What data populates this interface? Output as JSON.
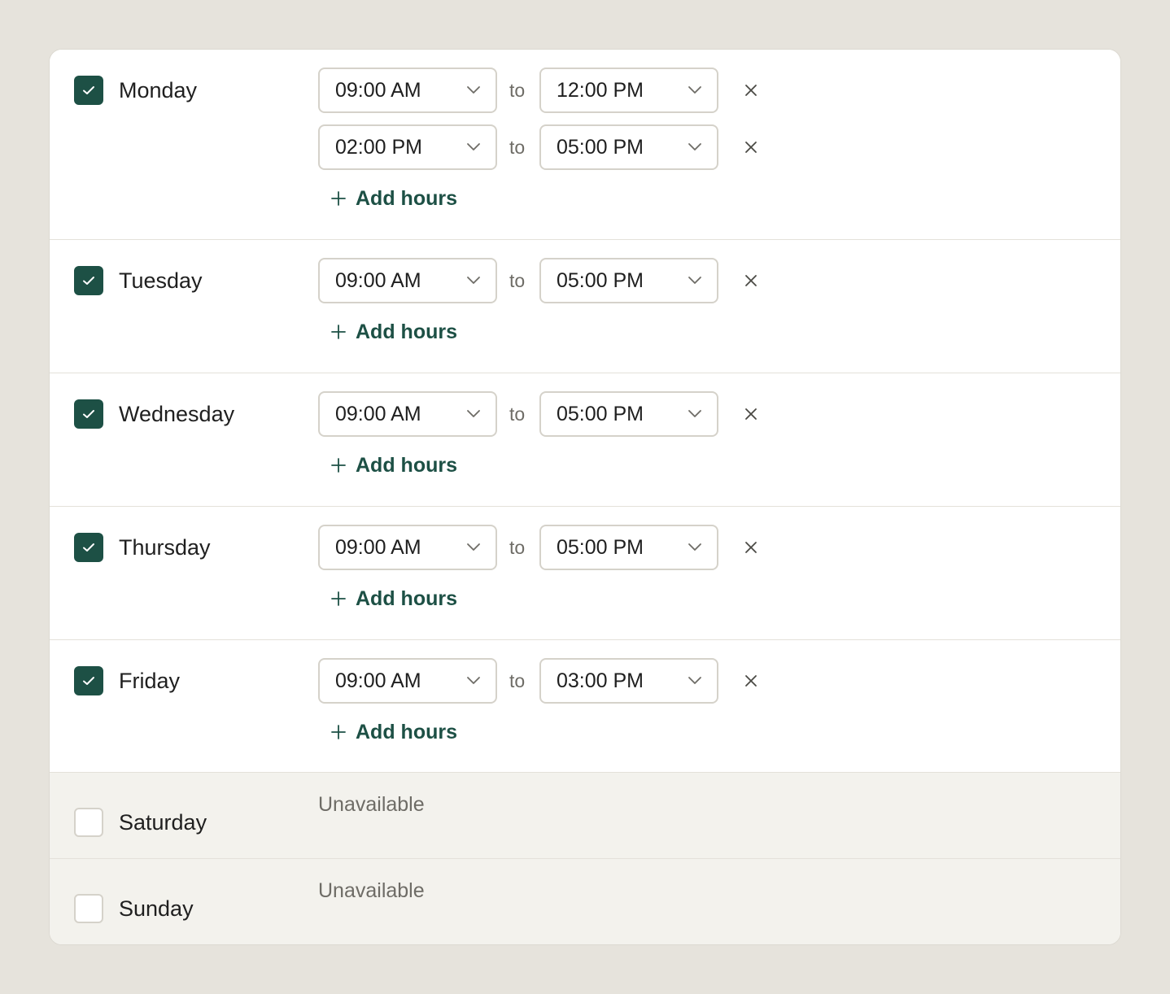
{
  "days": [
    {
      "name": "Monday",
      "checked": true,
      "slots": [
        {
          "from": "09:00 AM",
          "to": "12:00 PM"
        },
        {
          "from": "02:00 PM",
          "to": "05:00 PM"
        }
      ]
    },
    {
      "name": "Tuesday",
      "checked": true,
      "slots": [
        {
          "from": "09:00 AM",
          "to": "05:00 PM"
        }
      ]
    },
    {
      "name": "Wednesday",
      "checked": true,
      "slots": [
        {
          "from": "09:00 AM",
          "to": "05:00 PM"
        }
      ]
    },
    {
      "name": "Thursday",
      "checked": true,
      "slots": [
        {
          "from": "09:00 AM",
          "to": "05:00 PM"
        }
      ]
    },
    {
      "name": "Friday",
      "checked": true,
      "slots": [
        {
          "from": "09:00 AM",
          "to": "03:00 PM"
        }
      ]
    },
    {
      "name": "Saturday",
      "checked": false,
      "slots": []
    },
    {
      "name": "Sunday",
      "checked": false,
      "slots": []
    }
  ],
  "labels": {
    "to": "to",
    "add_hours": "Add hours",
    "unavailable": "Unavailable"
  },
  "colors": {
    "accent": "#1d5045",
    "background": "#e6e3dc",
    "card": "#ffffff",
    "unavailable_row": "#f3f2ed",
    "border": "#d5d2ca",
    "muted_text": "#6e6c66"
  },
  "icons": {
    "check": "checkmark-icon",
    "chevron": "chevron-down-icon",
    "remove": "close-icon",
    "add": "plus-icon"
  }
}
